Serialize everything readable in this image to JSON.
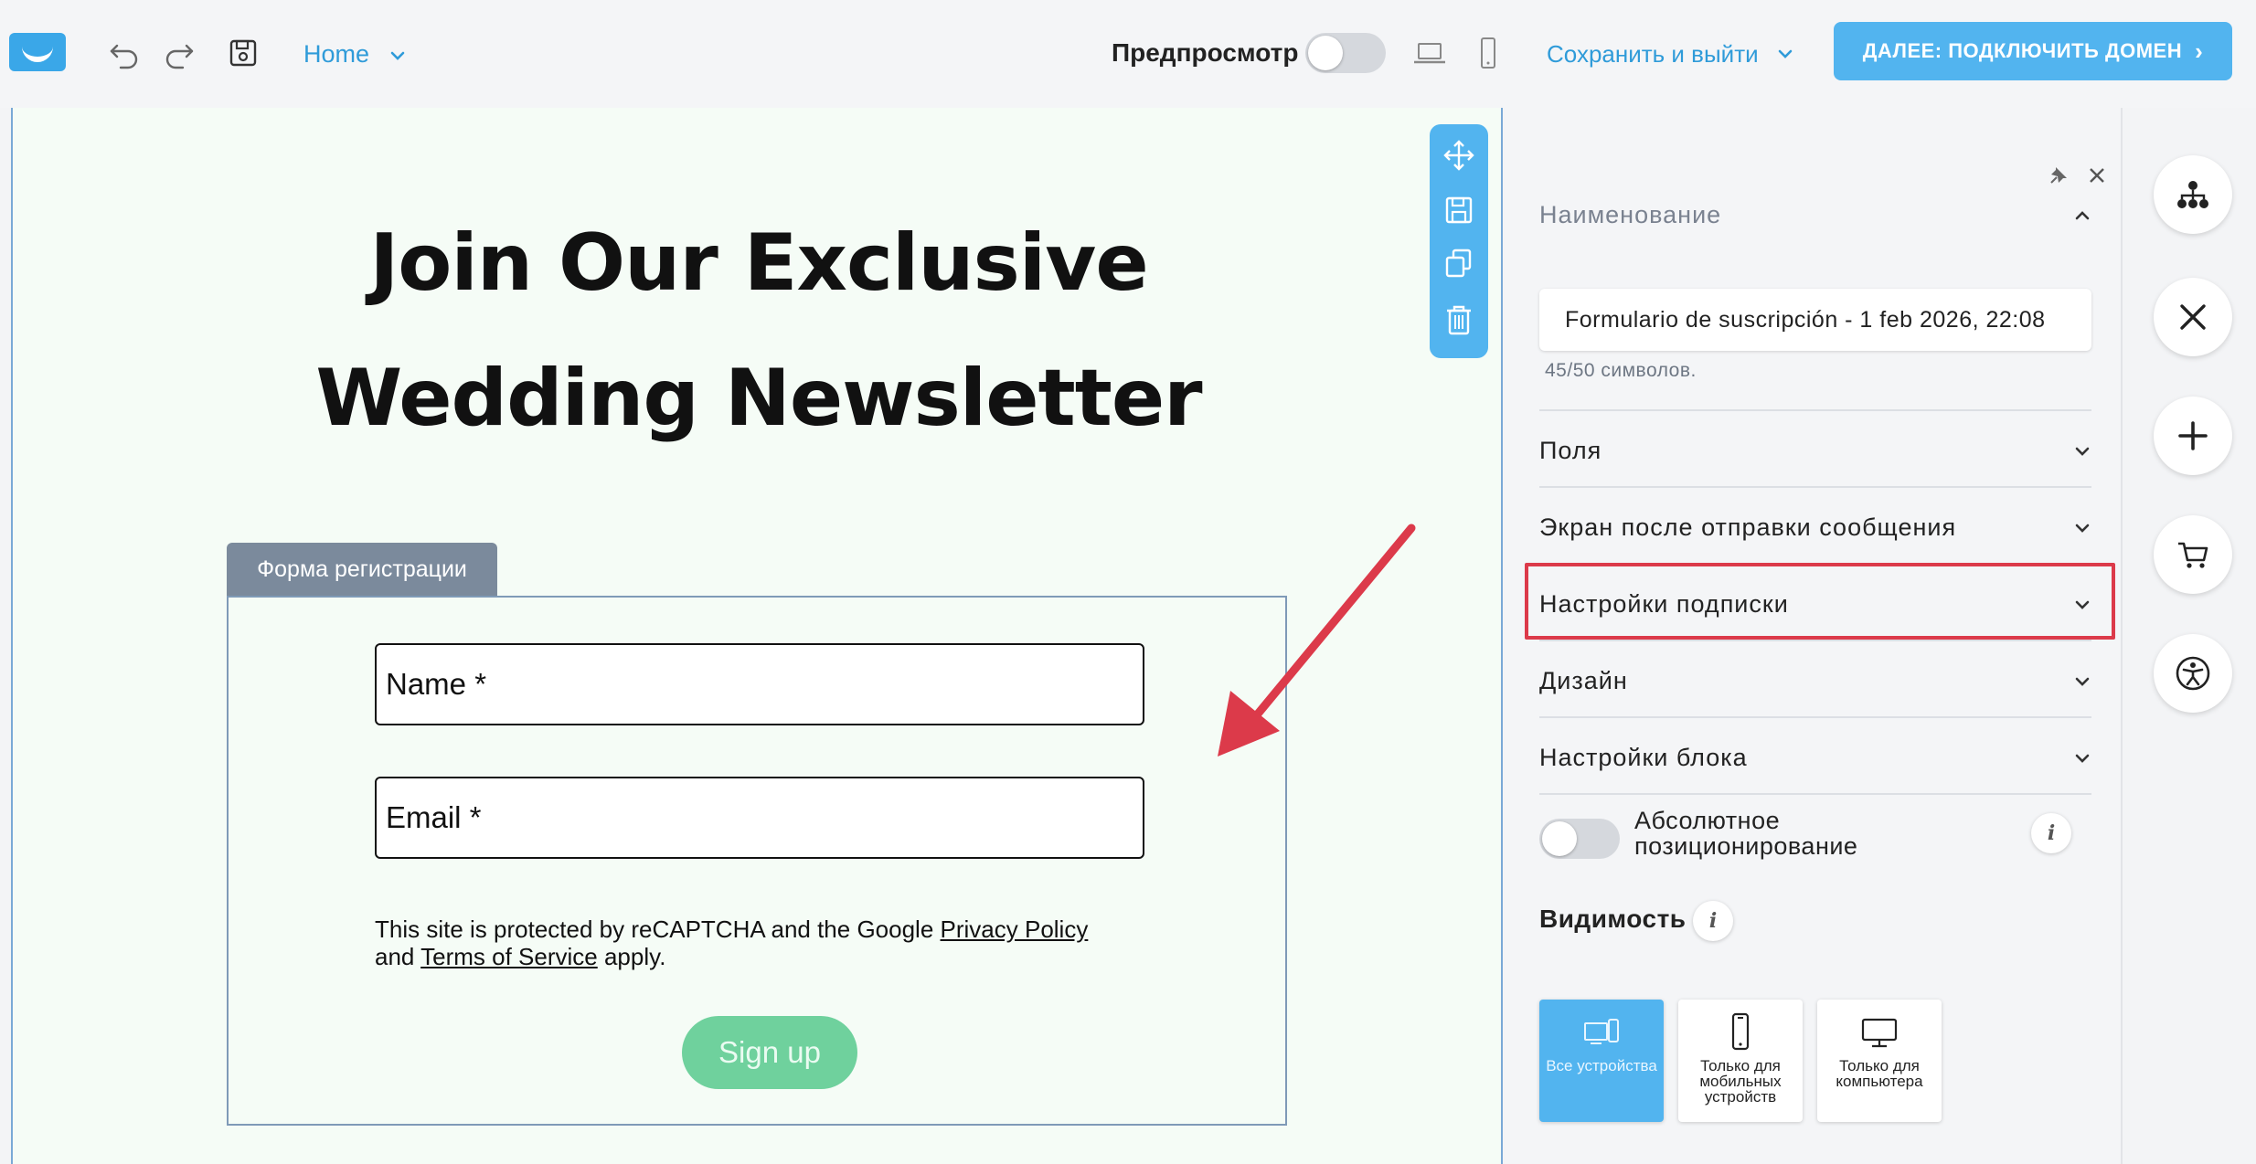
{
  "topbar": {
    "page_selector": "Home",
    "preview_label": "Предпросмотр",
    "save_exit_label": "Сохранить и выйти",
    "next_button_label": "ДАЛЕЕ: ПОДКЛЮЧИТЬ ДОМЕН",
    "preview_enabled": false
  },
  "canvas": {
    "headline_line1": "Join Our Exclusive",
    "headline_line2": "Wedding Newsletter",
    "form_tab_label": "Форма регистрации",
    "name_field": "Name *",
    "email_field": "Email *",
    "legal_prefix": "This site is protected by reCAPTCHA and the Google ",
    "privacy_link": "Privacy Policy",
    "legal_and": "and ",
    "terms_link": "Terms of Service",
    "legal_suffix": " apply.",
    "signup_label": "Sign up"
  },
  "panel": {
    "name_section": "Наименование",
    "form_name_value": "Formulario de suscripción - 1 feb 2026, 22:08",
    "char_count": "45/50 символов.",
    "sections": [
      "Поля",
      "Экран после отправки сообщения",
      "Настройки подписки",
      "Дизайн",
      "Настройки блока"
    ],
    "highlighted_section": "Настройки подписки",
    "absolute_positioning_label": "Абсолютное позиционирование",
    "absolute_positioning_enabled": false,
    "visibility_label": "Видимость",
    "visibility_options": [
      {
        "label": "Все устройства",
        "icon": "all-devices-icon",
        "active": true
      },
      {
        "label": "Только для мобильных устройств",
        "icon": "mobile-icon",
        "active": false
      },
      {
        "label": "Только для компьютера",
        "icon": "desktop-icon",
        "active": false
      }
    ]
  },
  "rail": [
    "sitemap-icon",
    "close-icon",
    "plus-icon",
    "cart-icon",
    "accessibility-icon"
  ],
  "colors": {
    "accent": "#52b4ef",
    "link": "#2f9bd9",
    "highlight": "#dc3a4a",
    "signup": "#6fd19d"
  }
}
